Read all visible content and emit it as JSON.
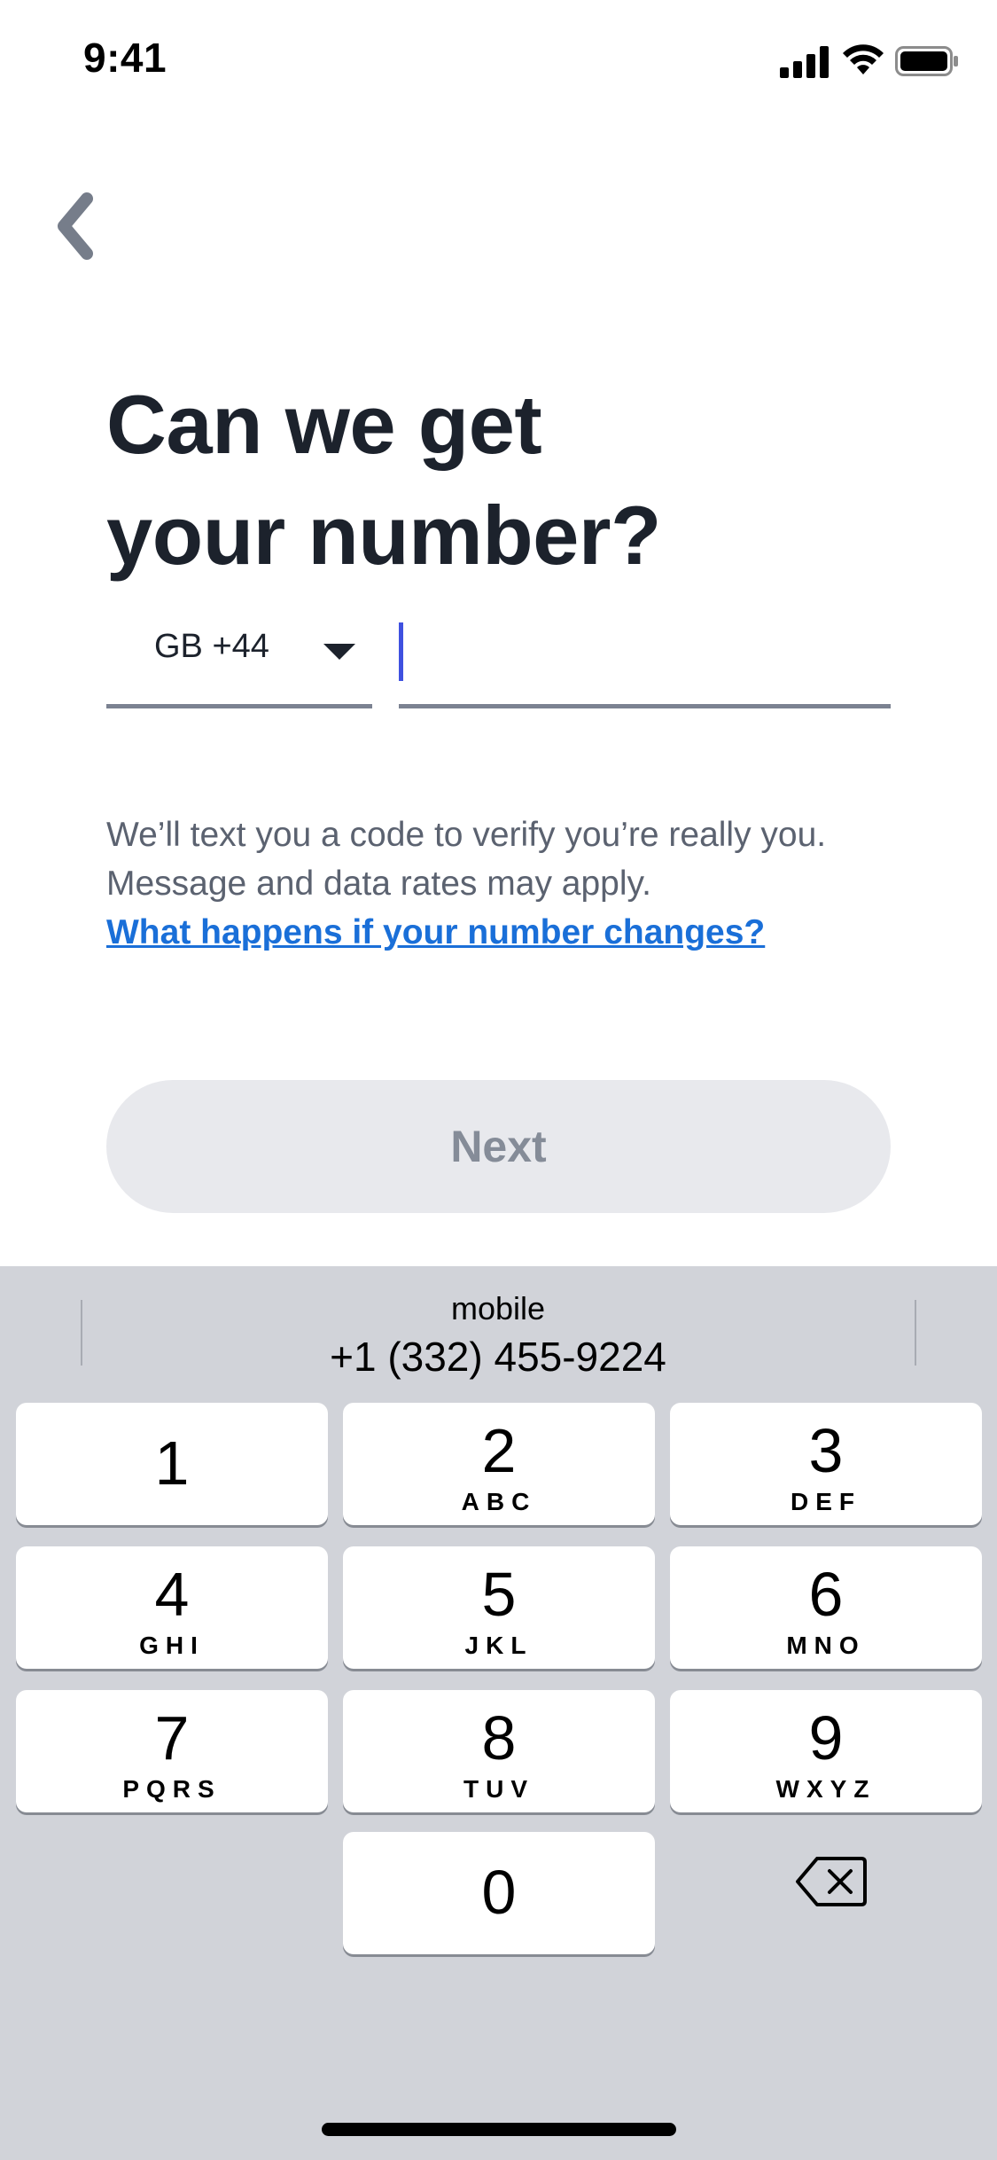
{
  "status_bar": {
    "time": "9:41"
  },
  "screen": {
    "title_line1": "Can we get",
    "title_line2": "your number?",
    "country_code": "GB +44",
    "phone_value": "",
    "helper_text": "We’ll text you a code to verify you’re really you. Message and data rates may apply.",
    "help_link": "What happens if your number changes?",
    "next_label": "Next"
  },
  "keyboard": {
    "suggestion": {
      "label": "mobile",
      "number": "+1 (332) 455-9224"
    },
    "keys": [
      {
        "num": "1",
        "letters": ""
      },
      {
        "num": "2",
        "letters": "ABC"
      },
      {
        "num": "3",
        "letters": "DEF"
      },
      {
        "num": "4",
        "letters": "GHI"
      },
      {
        "num": "5",
        "letters": "JKL"
      },
      {
        "num": "6",
        "letters": "MNO"
      },
      {
        "num": "7",
        "letters": "PQRS"
      },
      {
        "num": "8",
        "letters": "TUV"
      },
      {
        "num": "9",
        "letters": "WXYZ"
      },
      {
        "num": "0",
        "letters": ""
      }
    ]
  },
  "icons": {
    "back": "chevron-left-icon",
    "delete": "backspace-icon",
    "signal": "cellular-signal-icon",
    "wifi": "wifi-icon",
    "battery": "battery-icon"
  },
  "colors": {
    "text_primary": "#1c222c",
    "link": "#1a6fd8",
    "cursor": "#3f51e0",
    "button_disabled_bg": "#e8e9ed",
    "keyboard_bg": "#d1d3d9"
  }
}
